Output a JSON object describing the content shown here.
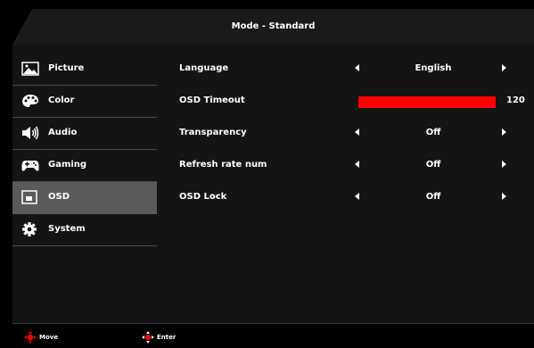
{
  "header": {
    "title": "Mode - Standard"
  },
  "sidebar": {
    "items": [
      {
        "label": "Picture",
        "icon": "picture-icon",
        "active": false
      },
      {
        "label": "Color",
        "icon": "palette-icon",
        "active": false
      },
      {
        "label": "Audio",
        "icon": "speaker-icon",
        "active": false
      },
      {
        "label": "Gaming",
        "icon": "gamepad-icon",
        "active": false
      },
      {
        "label": "OSD",
        "icon": "osd-window-icon",
        "active": true
      },
      {
        "label": "System",
        "icon": "gear-icon",
        "active": false
      }
    ]
  },
  "settings": {
    "language": {
      "label": "Language",
      "value": "English"
    },
    "osd_timeout": {
      "label": "OSD Timeout",
      "value": "120",
      "fill_fraction": 1.0
    },
    "transparency": {
      "label": "Transparency",
      "value": "Off"
    },
    "refresh_rate_num": {
      "label": "Refresh rate num",
      "value": "Off"
    },
    "osd_lock": {
      "label": "OSD Lock",
      "value": "Off"
    }
  },
  "footer": {
    "move_label": "Move",
    "enter_label": "Enter"
  },
  "colors": {
    "accent": "#ff0000",
    "active_bg": "#5a5a5a"
  }
}
